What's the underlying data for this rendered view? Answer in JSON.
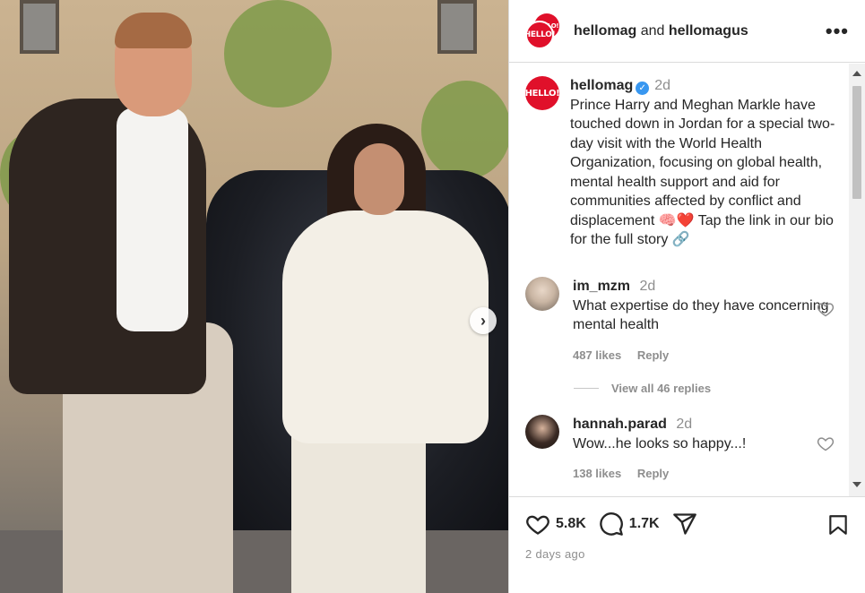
{
  "header": {
    "logo_text": "HELLO!",
    "account_primary": "hellomag",
    "joiner": "and",
    "account_secondary": "hellomagus",
    "more_label": "•••"
  },
  "caption": {
    "username": "hellomag",
    "verified_mark": "✓",
    "time": "2d",
    "text": "Prince Harry and Meghan Markle have touched down in Jordan for a special two-day visit with the World Health Organization, focusing on global health, mental health support and aid for communities affected by conflict and displacement 🧠❤️ Tap the link in our bio for the full story 🔗"
  },
  "comments": [
    {
      "username": "im_mzm",
      "time": "2d",
      "text": "What expertise do they have concerning mental health",
      "likes": "487 likes",
      "reply_label": "Reply"
    },
    {
      "username": "hannah.parad",
      "time": "2d",
      "text": "Wow...he looks so happy...!",
      "likes": "138 likes",
      "reply_label": "Reply"
    }
  ],
  "view_replies": "View all 46 replies",
  "actions": {
    "like_count": "5.8K",
    "comment_count": "1.7K",
    "posted": "2 days ago"
  },
  "photo": {
    "next_label": "›"
  },
  "colors": {
    "brand_red": "#e0102a",
    "verified_blue": "#3897f0",
    "muted": "#8e8e8e"
  }
}
